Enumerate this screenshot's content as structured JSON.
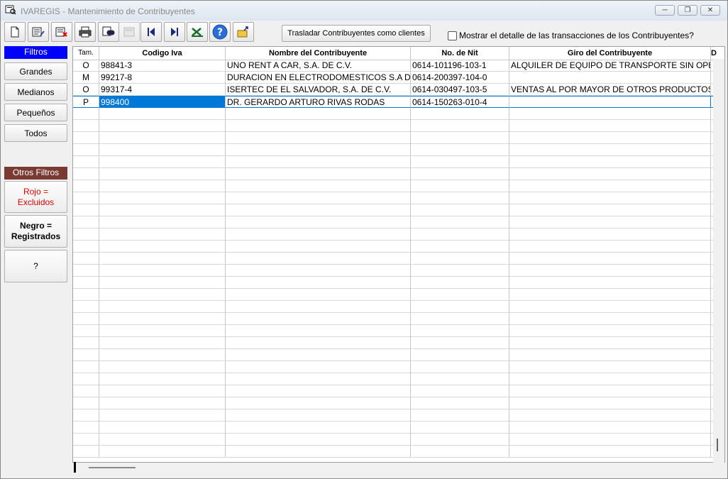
{
  "window": {
    "title": "IVAREGIS - Mantenimiento de Contribuyentes",
    "controls": [
      "minimize",
      "restore",
      "close"
    ]
  },
  "toolbar": {
    "icons": [
      "new-icon",
      "edit-icon",
      "delete-icon",
      "print-icon",
      "search-icon",
      "calculator-icon",
      "first-record-icon",
      "last-record-icon",
      "excel-icon",
      "help-icon",
      "export-icon"
    ],
    "trasladar_label": "Trasladar Contribuyentes como clientes",
    "detalle_label": "Mostrar el detalle de las transacciones de los Contribuyentes?",
    "detalle_checked": false
  },
  "filters": {
    "header": "Filtros",
    "header_color": "#0000ff",
    "items": [
      "Grandes",
      "Medianos",
      "Pequeños",
      "Todos"
    ],
    "otros_header": "Otros Filtros",
    "otros_header_color": "#7a3a32",
    "rojo_line1": "Rojo =",
    "rojo_line2": "Excluidos",
    "rojo_color": "#e00000",
    "negro_line1": "Negro =",
    "negro_line2": "Registrados",
    "help_label": "?"
  },
  "table": {
    "columns": [
      "Tam.",
      "Codigo Iva",
      "Nombre del Contribuyente",
      "No. de Nit",
      "Giro del Contribuyente",
      "D"
    ],
    "rows": [
      {
        "tam": "O",
        "codigo": "98841-3",
        "nombre": "UNO RENT A CAR, S.A. DE C.V.",
        "nit": "0614-101196-103-1",
        "giro": "ALQUILER DE EQUIPO DE TRANSPORTE SIN OPE"
      },
      {
        "tam": "M",
        "codigo": "99217-8",
        "nombre": "DURACION EN ELECTRODOMESTICOS S.A DE",
        "nit": "0614-200397-104-0",
        "giro": ""
      },
      {
        "tam": "O",
        "codigo": "99317-4",
        "nombre": "ISERTEC DE EL SALVADOR, S.A. DE C.V.",
        "nit": "0614-030497-103-5",
        "giro": "VENTAS AL POR MAYOR DE OTROS PRODUCTOS"
      },
      {
        "tam": "P",
        "codigo": "998400",
        "nombre": "DR. GERARDO ARTURO RIVAS RODAS",
        "nit": "0614-150263-010-4",
        "giro": ""
      }
    ],
    "selected_row": 3,
    "selection_color": "#0078d7"
  }
}
